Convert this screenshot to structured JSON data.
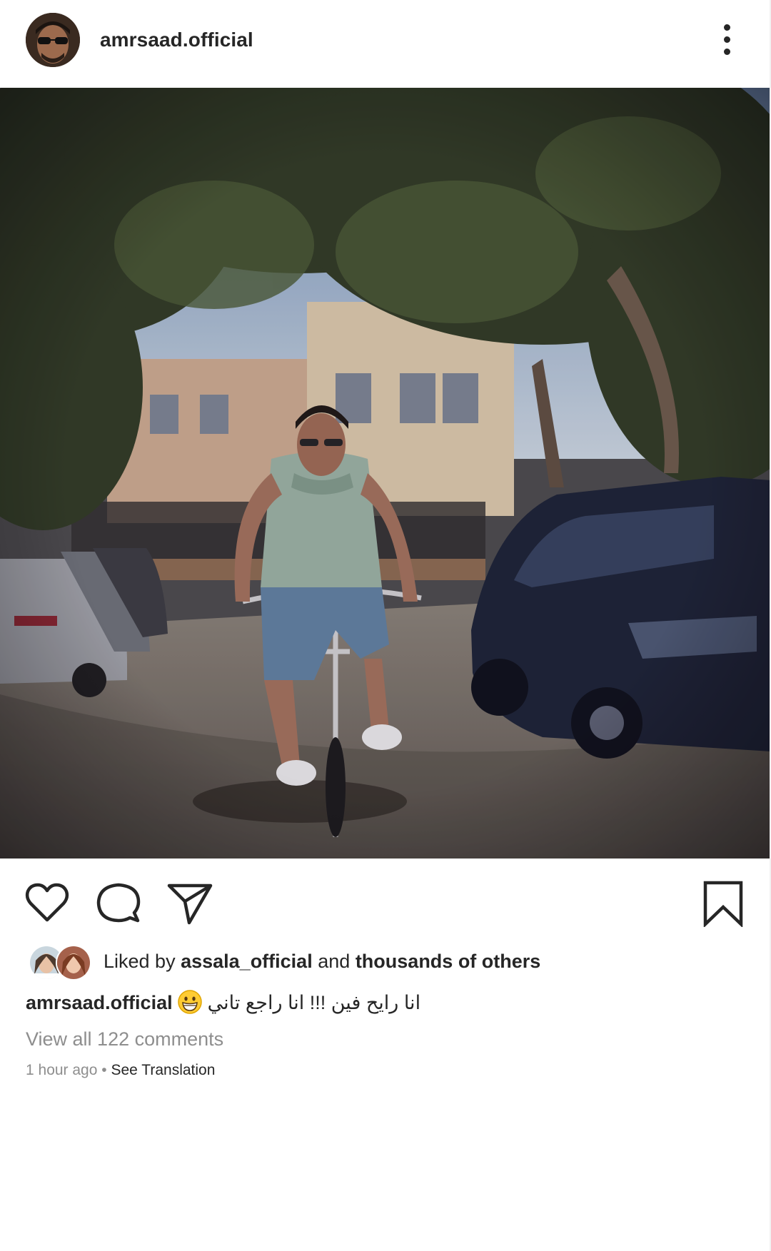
{
  "post": {
    "username": "amrsaad.official",
    "menu_icon": "more-vertical-icon",
    "photo_alt": "photo",
    "actions": {
      "like_icon": "heart-icon",
      "comment_icon": "comment-icon",
      "share_icon": "send-icon",
      "save_icon": "bookmark-icon"
    },
    "likes": {
      "prefix": "Liked by",
      "first_liker": "assala_official",
      "conjunction": "and",
      "others": "thousands of others"
    },
    "caption": {
      "username": "amrsaad.official",
      "text": "انا رايح فين !!! انا راجع تاني",
      "emoji": "grinning-face-emoji"
    },
    "comments_link": "View all 122 comments",
    "timestamp": "1 hour ago",
    "separator": "•",
    "translation_link": "See Translation"
  },
  "colors": {
    "text": "#262626",
    "secondary_text": "#8e8e8e",
    "background": "#ffffff"
  }
}
